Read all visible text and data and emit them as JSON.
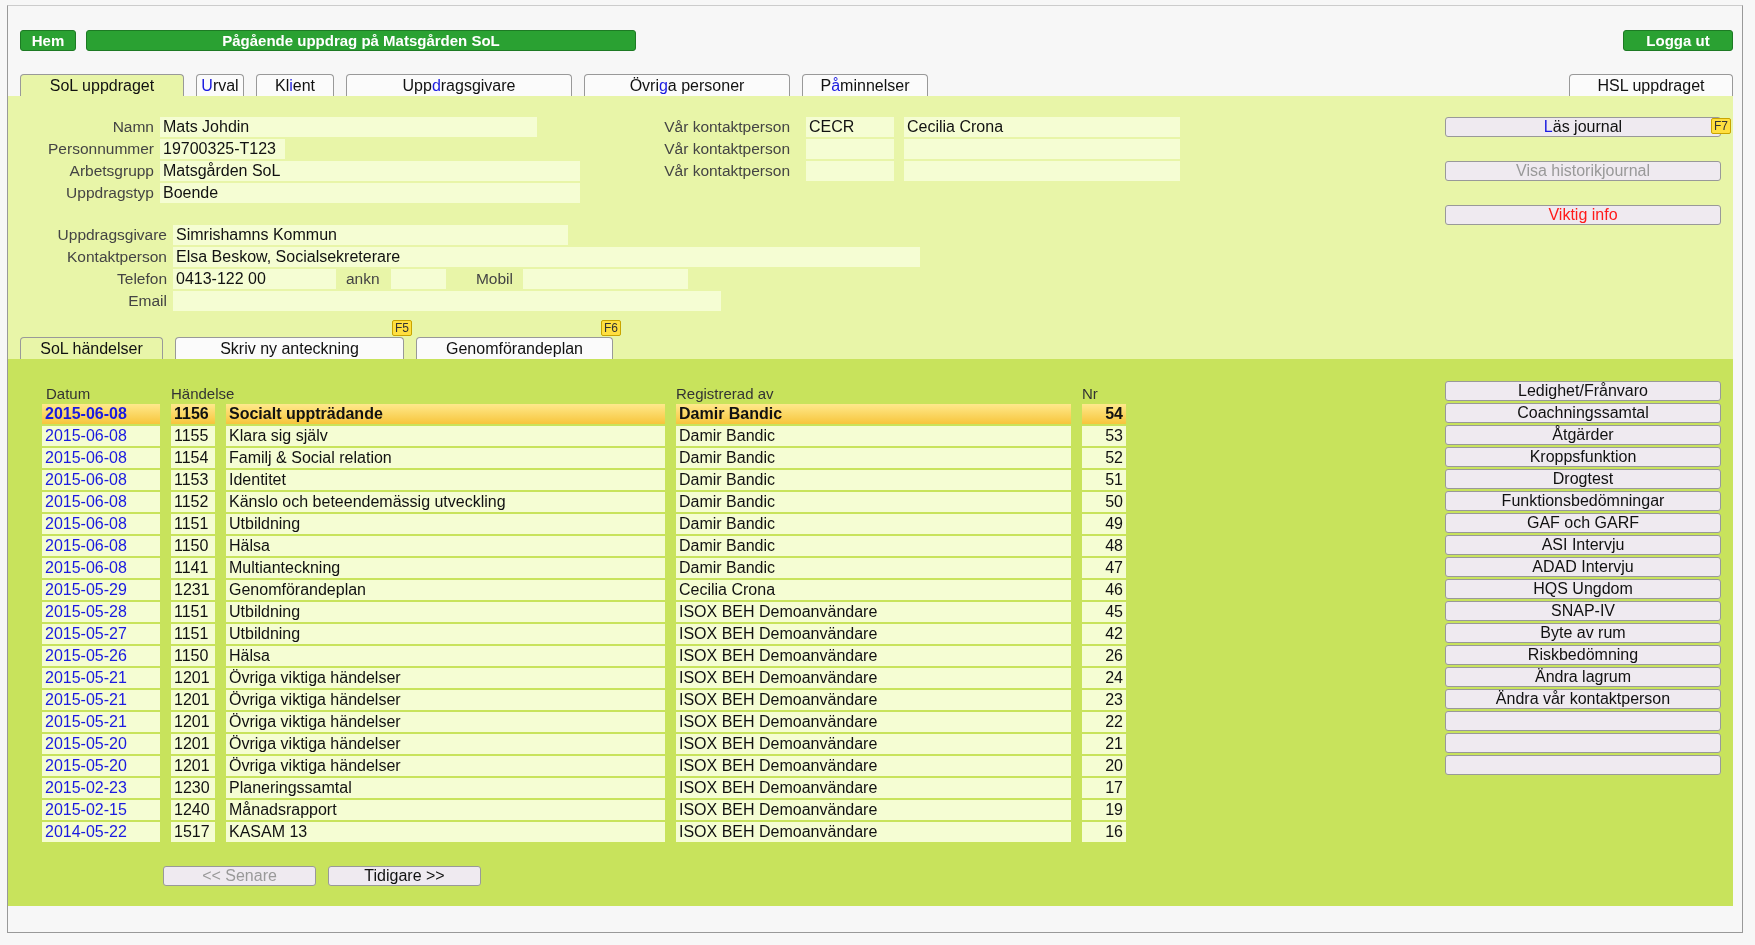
{
  "top_bar": {
    "home": "Hem",
    "title": "Pågående uppdrag på Matsgården SoL",
    "logout": "Logga ut"
  },
  "tabs": [
    {
      "selected": true,
      "parts": [
        {
          "text": "SoL uppdraget",
          "key": false
        }
      ]
    },
    {
      "selected": false,
      "parts": [
        {
          "text": "U",
          "key": true
        },
        {
          "text": "rval",
          "key": false
        }
      ]
    },
    {
      "selected": false,
      "parts": [
        {
          "text": "Kl",
          "key": false
        },
        {
          "text": "i",
          "key": true
        },
        {
          "text": "ent",
          "key": false
        }
      ]
    },
    {
      "selected": false,
      "parts": [
        {
          "text": "Upp",
          "key": false
        },
        {
          "text": "d",
          "key": true
        },
        {
          "text": "ragsgivare",
          "key": false
        }
      ]
    },
    {
      "selected": false,
      "parts": [
        {
          "text": "Övri",
          "key": false
        },
        {
          "text": "g",
          "key": true
        },
        {
          "text": "a personer",
          "key": false
        }
      ]
    },
    {
      "selected": false,
      "parts": [
        {
          "text": "P",
          "key": false
        },
        {
          "text": "å",
          "key": true
        },
        {
          "text": "minnelser",
          "key": false
        }
      ]
    }
  ],
  "right_tabs": [
    {
      "selected": false,
      "parts": [
        {
          "text": "HSL uppdraget",
          "key": false
        }
      ]
    }
  ],
  "client": [
    {
      "label": "Namn",
      "value": "Mats Johdin"
    },
    {
      "label": "Personnummer",
      "value": "19700325-T123"
    },
    {
      "label": "Arbetsgrupp",
      "value": "Matsgården SoL"
    },
    {
      "label": "Uppdragstyp",
      "value": "Boende"
    }
  ],
  "contacts": [
    {
      "label": "Vår kontaktperson",
      "code": "CECR",
      "name": "Cecilia Crona"
    },
    {
      "label": "Vår kontaktperson"
    },
    {
      "label": "Vår kontaktperson"
    }
  ],
  "commissioner": {
    "label": "Uppdragsgivare",
    "value": "Simrishamns Kommun"
  },
  "contact_person": {
    "label": "Kontaktperson",
    "value": "Elsa Beskow, Socialsekreterare"
  },
  "phone": {
    "label": "Telefon",
    "value": "0413-122 00",
    "ext_label": "ankn",
    "mobile_label": "Mobil"
  },
  "email": {
    "label": "Email"
  },
  "side_buttons": [
    {
      "kind": "normal",
      "disabled": false,
      "hotkey": "F7",
      "parts": [
        {
          "text": "L",
          "key": true
        },
        {
          "text": "äs journal",
          "key": false
        }
      ]
    },
    {
      "kind": "normal",
      "disabled": true,
      "parts": [
        {
          "text": "Visa historikjournal",
          "key": false
        }
      ]
    },
    {
      "kind": "warning",
      "disabled": false,
      "parts": [
        {
          "text": "Viktig info",
          "key": false
        }
      ]
    }
  ],
  "sub_tabs": [
    {
      "label": "SoL händelser",
      "selected": true
    },
    {
      "label": "Skriv ny anteckning",
      "selected": false,
      "hotkey": "F5"
    },
    {
      "label": "Genomförandeplan",
      "selected": false,
      "hotkey": "F6"
    }
  ],
  "events": {
    "columns": [
      "Datum",
      "Händelse",
      "Registrerad av",
      "Nr"
    ],
    "rows": [
      {
        "date": "2015-06-08",
        "code": "1156",
        "event": "Socialt uppträdande",
        "by": "Damir Bandic",
        "nr": "54",
        "selected": true
      },
      {
        "date": "2015-06-08",
        "code": "1155",
        "event": "Klara sig själv",
        "by": "Damir Bandic",
        "nr": "53",
        "selected": false
      },
      {
        "date": "2015-06-08",
        "code": "1154",
        "event": "Familj & Social relation",
        "by": "Damir Bandic",
        "nr": "52",
        "selected": false
      },
      {
        "date": "2015-06-08",
        "code": "1153",
        "event": "Identitet",
        "by": "Damir Bandic",
        "nr": "51",
        "selected": false
      },
      {
        "date": "2015-06-08",
        "code": "1152",
        "event": "Känslo och beteendemässig utveckling",
        "by": "Damir Bandic",
        "nr": "50",
        "selected": false
      },
      {
        "date": "2015-06-08",
        "code": "1151",
        "event": "Utbildning",
        "by": "Damir Bandic",
        "nr": "49",
        "selected": false
      },
      {
        "date": "2015-06-08",
        "code": "1150",
        "event": "Hälsa",
        "by": "Damir Bandic",
        "nr": "48",
        "selected": false
      },
      {
        "date": "2015-06-08",
        "code": "1141",
        "event": "Multianteckning",
        "by": "Damir Bandic",
        "nr": "47",
        "selected": false
      },
      {
        "date": "2015-05-29",
        "code": "1231",
        "event": "Genomförandeplan",
        "by": "Cecilia Crona",
        "nr": "46",
        "selected": false
      },
      {
        "date": "2015-05-28",
        "code": "1151",
        "event": "Utbildning",
        "by": "ISOX BEH Demoanvändare",
        "nr": "45",
        "selected": false
      },
      {
        "date": "2015-05-27",
        "code": "1151",
        "event": "Utbildning",
        "by": "ISOX BEH Demoanvändare",
        "nr": "42",
        "selected": false
      },
      {
        "date": "2015-05-26",
        "code": "1150",
        "event": "Hälsa",
        "by": "ISOX BEH Demoanvändare",
        "nr": "26",
        "selected": false
      },
      {
        "date": "2015-05-21",
        "code": "1201",
        "event": "Övriga viktiga händelser",
        "by": "ISOX BEH Demoanvändare",
        "nr": "24",
        "selected": false
      },
      {
        "date": "2015-05-21",
        "code": "1201",
        "event": "Övriga viktiga händelser",
        "by": "ISOX BEH Demoanvändare",
        "nr": "23",
        "selected": false
      },
      {
        "date": "2015-05-21",
        "code": "1201",
        "event": "Övriga viktiga händelser",
        "by": "ISOX BEH Demoanvändare",
        "nr": "22",
        "selected": false
      },
      {
        "date": "2015-05-20",
        "code": "1201",
        "event": "Övriga viktiga händelser",
        "by": "ISOX BEH Demoanvändare",
        "nr": "21",
        "selected": false
      },
      {
        "date": "2015-05-20",
        "code": "1201",
        "event": "Övriga viktiga händelser",
        "by": "ISOX BEH Demoanvändare",
        "nr": "20",
        "selected": false
      },
      {
        "date": "2015-02-23",
        "code": "1230",
        "event": "Planeringssamtal",
        "by": "ISOX BEH Demoanvändare",
        "nr": "17",
        "selected": false
      },
      {
        "date": "2015-02-15",
        "code": "1240",
        "event": "Månadsrapport",
        "by": "ISOX BEH Demoanvändare",
        "nr": "19",
        "selected": false
      },
      {
        "date": "2014-05-22",
        "code": "1517",
        "event": "KASAM 13",
        "by": "ISOX BEH Demoanvändare",
        "nr": "16",
        "selected": false
      }
    ]
  },
  "pager": [
    {
      "label": "<< Senare",
      "disabled": true
    },
    {
      "label": "Tidigare >>",
      "disabled": false
    }
  ],
  "actions": [
    {
      "kind": "action",
      "label": "Ledighet/Frånvaro"
    },
    {
      "kind": "action",
      "label": "Coachningssamtal"
    },
    {
      "kind": "action",
      "label": "Åtgärder"
    },
    {
      "kind": "action",
      "label": "Kroppsfunktion"
    },
    {
      "kind": "action",
      "label": "Drogtest"
    },
    {
      "kind": "action",
      "label": "Funktionsbedömningar"
    },
    {
      "kind": "action",
      "label": "GAF och GARF"
    },
    {
      "kind": "action",
      "label": "ASI Intervju"
    },
    {
      "kind": "action",
      "label": "ADAD Intervju"
    },
    {
      "kind": "action",
      "label": "HQS Ungdom"
    },
    {
      "kind": "action",
      "label": "SNAP-IV"
    },
    {
      "kind": "action",
      "label": "Byte av rum"
    },
    {
      "kind": "action",
      "label": "Riskbedömning"
    },
    {
      "kind": "action",
      "label": "Ändra lagrum"
    },
    {
      "kind": "action",
      "label": "Ändra vår kontaktperson"
    },
    {
      "kind": "blank"
    },
    {
      "kind": "blank"
    },
    {
      "kind": "blank"
    }
  ]
}
